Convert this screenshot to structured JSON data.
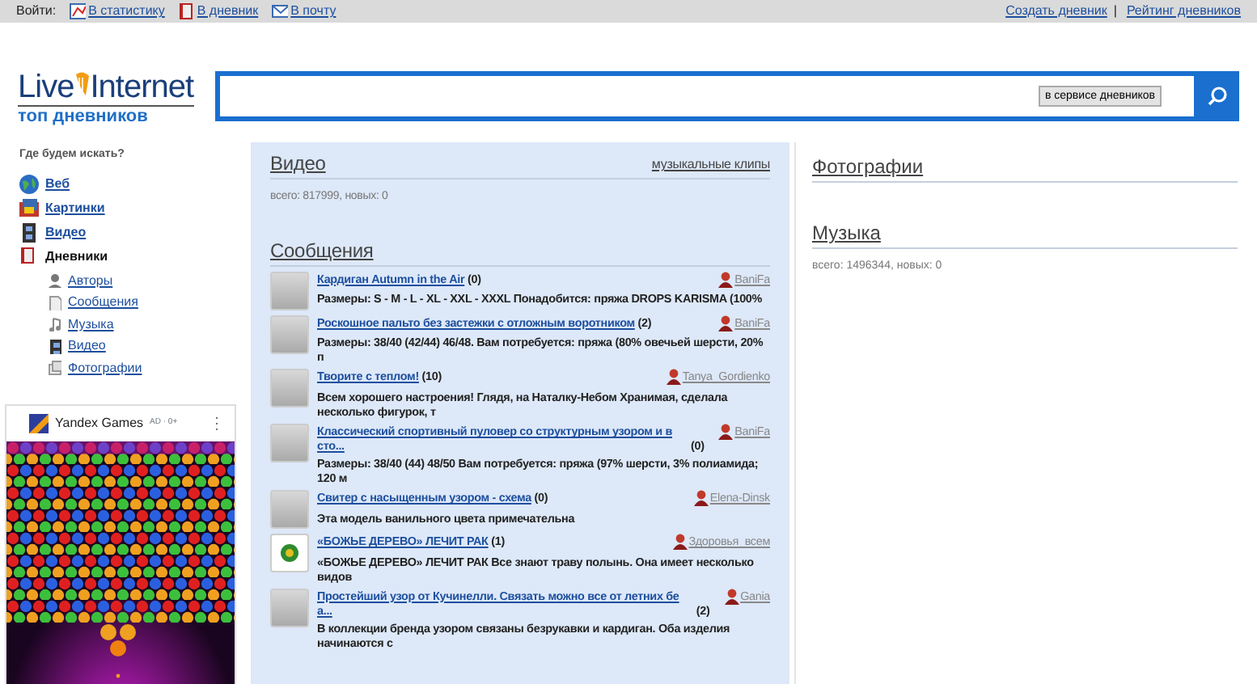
{
  "topbar": {
    "login_label": "Войти:",
    "links": [
      "В статистику",
      "В дневник",
      "В почту"
    ],
    "right_links": [
      "Создать дневник",
      "Рейтинг дневников"
    ],
    "separator": "|"
  },
  "logo": {
    "word_1": "Live",
    "word_2": "Internet",
    "subtitle": "топ дневников"
  },
  "search": {
    "scope_button": "в сервисе дневников"
  },
  "sidebar": {
    "heading": "Где будем искать?",
    "items": [
      {
        "label": "Веб",
        "selected": false
      },
      {
        "label": "Картинки",
        "selected": false
      },
      {
        "label": "Видео",
        "selected": false
      },
      {
        "label": "Дневники",
        "selected": true,
        "children": [
          {
            "label": "Авторы"
          },
          {
            "label": "Сообщения"
          },
          {
            "label": "Музыка"
          },
          {
            "label": "Видео"
          },
          {
            "label": "Фотографии"
          }
        ]
      }
    ]
  },
  "ad": {
    "brand": "Yandex Games",
    "badge": "AD · 0+",
    "menu": "⋮",
    "kind": "picture"
  },
  "video": {
    "title": "Видео",
    "link": "музыкальные клипы",
    "stats": "всего: 817999, новых: 0"
  },
  "messages": {
    "title": "Сообщения",
    "items": [
      {
        "title": "Кардиган Autumn in the Air",
        "count": "(0)",
        "author": "BaniFa",
        "text": "Размеры: S - M - L - XL - XXL - XXXL Понадобится: пряжа DROPS KARISMA (100%",
        "kind": "placeholder"
      },
      {
        "title": "Роскошное пальто без застежки с отложным воротником",
        "count": "(2)",
        "author": "BaniFa",
        "text": "Размеры: 38/40 (42/44) 46/48. Вам потребуется: пряжа (80% овечьей шерсти, 20% п",
        "kind": "placeholder"
      },
      {
        "title": "Творите с теплом!",
        "count": "(10)",
        "author": "Tanya_Gordienko",
        "text": "Всем хорошего настроения! Глядя, на Наталку-Небом Хранимая, сделала несколько фигурок, т",
        "kind": "placeholder"
      },
      {
        "title": "Классический спортивный пуловер со структурным узором и в сто...",
        "count": "(0)",
        "author": "BaniFa",
        "text": "Размеры: 38/40 (44) 48/50 Вам потребуется: пряжа (97% шерсти, 3% полиамида; 120 м",
        "kind": "placeholder"
      },
      {
        "title": "Свитер с насыщенным узором - схема",
        "count": "(0)",
        "author": "Elena-Dinsk",
        "text": "Эта модель ванильного цвета примечательна",
        "kind": "placeholder"
      },
      {
        "title": "«БОЖЬЕ ДЕРЕВО» ЛЕЧИТ РАК",
        "count": "(1)",
        "author": "Здоровья_всем",
        "text": "«БОЖЬЕ ДЕРЕВО» ЛЕЧИТ РАК  Все знают траву полынь. Она имеет несколько видов"
      },
      {
        "title": "Простейший узор от Кучинелли. Связать можно все от летних бе а...",
        "count": "(2)",
        "author": "Gania",
        "text": "В коллекции бренда узором связаны безрукавки и кардиган. Оба изделия начинаются с",
        "kind": "placeholder"
      }
    ]
  },
  "photos": {
    "title": "Фотографии"
  },
  "music": {
    "title": "Музыка",
    "stats": "всего: 1496344, новых: 0"
  }
}
